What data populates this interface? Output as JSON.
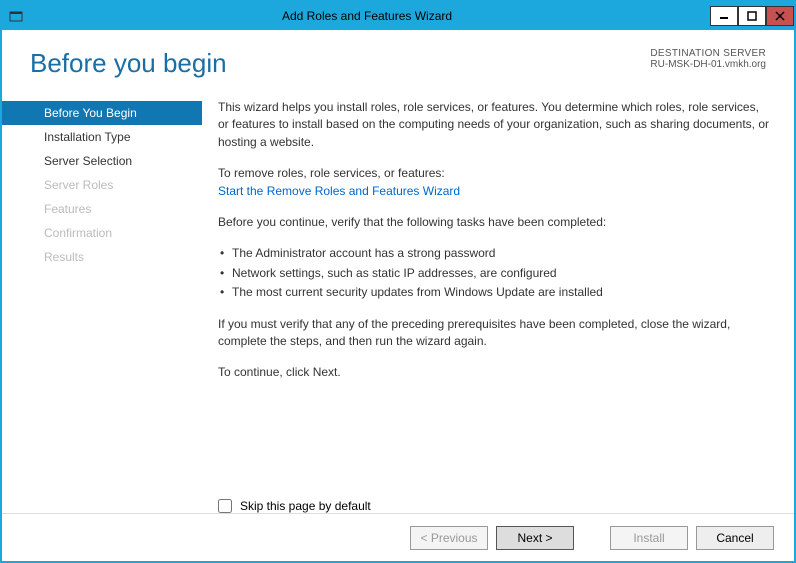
{
  "titlebar": {
    "title": "Add Roles and Features Wizard"
  },
  "header": {
    "page_title": "Before you begin",
    "dest_label": "DESTINATION SERVER",
    "dest_value": "RU-MSK-DH-01.vmkh.org"
  },
  "sidebar": {
    "items": [
      {
        "label": "Before You Begin",
        "state": "active"
      },
      {
        "label": "Installation Type",
        "state": "enabled"
      },
      {
        "label": "Server Selection",
        "state": "enabled"
      },
      {
        "label": "Server Roles",
        "state": "disabled"
      },
      {
        "label": "Features",
        "state": "disabled"
      },
      {
        "label": "Confirmation",
        "state": "disabled"
      },
      {
        "label": "Results",
        "state": "disabled"
      }
    ]
  },
  "content": {
    "intro": "This wizard helps you install roles, role services, or features. You determine which roles, role services, or features to install based on the computing needs of your organization, such as sharing documents, or hosting a website.",
    "remove_label": "To remove roles, role services, or features:",
    "remove_link": "Start the Remove Roles and Features Wizard",
    "verify_intro": "Before you continue, verify that the following tasks have been completed:",
    "bullets": [
      "The Administrator account has a strong password",
      "Network settings, such as static IP addresses, are configured",
      "The most current security updates from Windows Update are installed"
    ],
    "must_verify": "If you must verify that any of the preceding prerequisites have been completed, close the wizard, complete the steps, and then run the wizard again.",
    "continue_hint": "To continue, click Next.",
    "skip_label": "Skip this page by default"
  },
  "footer": {
    "previous": "< Previous",
    "next": "Next >",
    "install": "Install",
    "cancel": "Cancel"
  }
}
